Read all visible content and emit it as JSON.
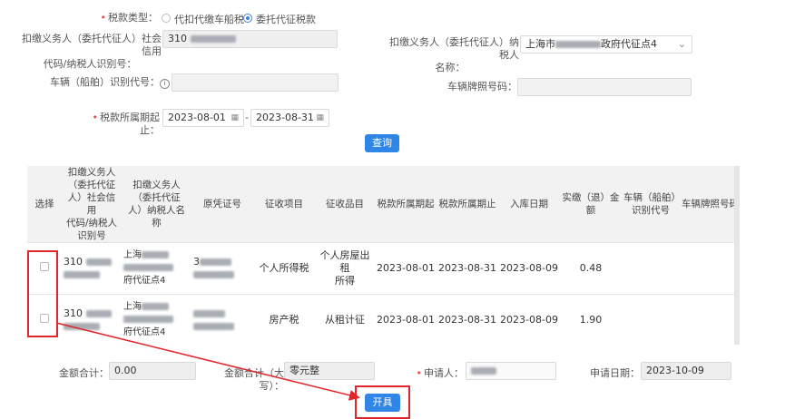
{
  "filters": {
    "tax_type_label": "税款类型：",
    "tax_type_options": [
      "代扣代缴车船税",
      "委托代征税款"
    ],
    "agent_id_label_line1": "扣缴义务人（委托代征人）社会信用",
    "agent_id_label_line2": "代码/纳税人识别号：",
    "agent_id_value": "310",
    "agent_name_label_line1": "扣缴义务人（委托代征人）纳税人",
    "agent_name_label_line2": "名称：",
    "agent_name_prefix": "上海市",
    "agent_name_suffix": "政府代征点4",
    "vehicle_id_label": "车辆（船舶）识别代号：",
    "plate_label": "车辆牌照号码：",
    "period_label": "税款所属期起止：",
    "period_start": "2023-08-01",
    "period_sep": "-",
    "period_end": "2023-08-31",
    "query_button": "查询"
  },
  "table": {
    "headers": {
      "select": "选择",
      "agent_id": [
        "扣缴义务人",
        "（委托代征",
        "人）社会信用",
        "代码/纳税人",
        "识别号"
      ],
      "agent_name": [
        "扣缴义务人",
        "（委托代征",
        "人）纳税人名",
        "称"
      ],
      "voucher": "原凭证号",
      "item": "征收项目",
      "subitem": "征收品目",
      "period_start": "税款所属期起",
      "period_end": "税款所属期止",
      "storage_date": "入库日期",
      "amount": [
        "实缴（退）金",
        "额"
      ],
      "vehicle_id": [
        "车辆（船舶）",
        "识别代号"
      ],
      "plate": "车辆牌照号码"
    },
    "rows": [
      {
        "agent_id": "310",
        "agent_name_top": "上海",
        "agent_name_bottom": "府代征点4",
        "voucher": "3",
        "item": "个人所得税",
        "subitem": [
          "个人房屋出租",
          "所得"
        ],
        "period_start": "2023-08-01",
        "period_end": "2023-08-31",
        "storage_date": "2023-08-09",
        "amount": "0.48"
      },
      {
        "agent_id": "310",
        "agent_name_top": "上海",
        "agent_name_bottom": "府代征点4",
        "voucher": "",
        "item": "房产税",
        "subitem": [
          "从租计征"
        ],
        "period_start": "2023-08-01",
        "period_end": "2023-08-31",
        "storage_date": "2023-08-09",
        "amount": "1.90"
      }
    ]
  },
  "footer": {
    "total_label": "金额合计：",
    "total_value": "0.00",
    "total_upper_label": "金额合计（大写）：",
    "total_upper_value": "零元整",
    "applicant_label": "申请人：",
    "apply_date_label": "申请日期：",
    "apply_date_value": "2023-10-09",
    "issue_button": "开具"
  },
  "colors": {
    "accent": "#2f86e6",
    "annotation": "#e0262b"
  }
}
